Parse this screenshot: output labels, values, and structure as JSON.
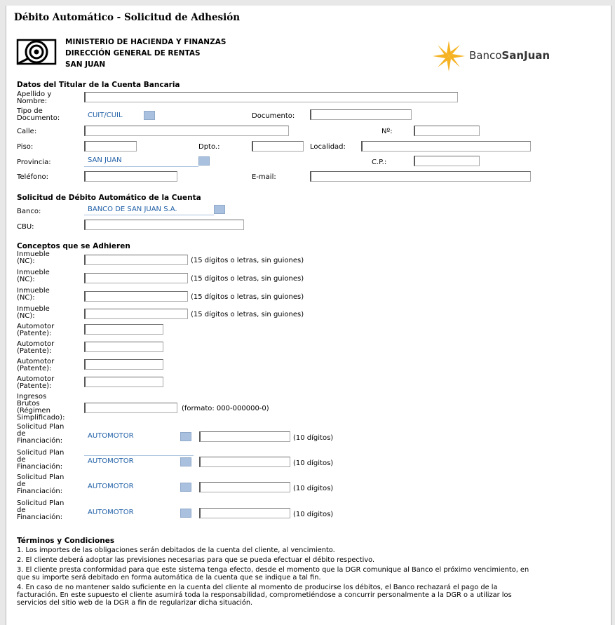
{
  "page_title": "Débito Automático - Solicitud de Adhesión",
  "ministry": {
    "line1": "MINISTERIO DE HACIENDA Y FINANZAS",
    "line2": "DIRECCIÓN GENERAL DE RENTAS",
    "line3": "SAN JUAN"
  },
  "bank_logo": {
    "prefix": "Banco",
    "name": "SanJuan",
    "color": "#f5b323"
  },
  "titular": {
    "heading": "Datos del Titular de la Cuenta Bancaria",
    "apellido_label_1": "Apellido y",
    "apellido_label_2": "Nombre:",
    "tipo_doc_label_1": "Tipo de",
    "tipo_doc_label_2": "Documento:",
    "tipo_doc_value": "CUIT/CUIL",
    "documento_label": "Documento:",
    "calle_label": "Calle:",
    "numero_label": "Nº:",
    "piso_label": "Piso:",
    "dpto_label": "Dpto.:",
    "localidad_label": "Localidad:",
    "provincia_label": "Provincia:",
    "provincia_value": "SAN JUAN",
    "cp_label": "C.P.:",
    "telefono_label": "Teléfono:",
    "email_label": "E-mail:"
  },
  "solicitud": {
    "heading": "Solicitud de Débito Automático de la Cuenta",
    "banco_label": "Banco:",
    "banco_value": "BANCO DE SAN JUAN S.A.",
    "cbu_label": "CBU:"
  },
  "conceptos": {
    "heading": "Conceptos que se Adhieren",
    "inmueble_label_1": "Inmueble",
    "inmueble_label_2": "(NC):",
    "inmueble_hint": "(15 dígitos o letras, sin guiones)",
    "automotor_label_1": "Automotor",
    "automotor_label_2": "(Patente):",
    "ingresos_label_1": "Ingresos",
    "ingresos_label_2": "Brutos",
    "ingresos_label_3": "(Régimen",
    "ingresos_label_4": "Simplificado):",
    "ingresos_hint": "(formato: 000-000000-0)",
    "plan_label_1": "Solicitud Plan",
    "plan_label_2": "de",
    "plan_label_3": "Financiación:",
    "plan_value": "AUTOMOTOR",
    "plan_hint": "(10 dígitos)"
  },
  "terms": {
    "heading": "Términos y Condiciones",
    "t1": "1. Los importes de las obligaciones serán debitados de la cuenta del cliente, al vencimiento.",
    "t2": "2. El cliente deberá adoptar las previsiones necesarias para que se pueda efectuar el débito respectivo.",
    "t3": "3. El cliente presta conformidad para que este sistema tenga efecto, desde el momento que la DGR comunique al Banco el próximo vencimiento, en que su importe será debitado en forma automática de la cuenta que se indique a tal fin.",
    "t4": "4. En caso de no mantener saldo suficiente en la cuenta del cliente al momento de producirse los débitos, el Banco rechazará el pago de la facturación. En este supuesto el cliente asumirá toda la responsabilidad, comprometiéndose a concurrir personalmente a la DGR o a utilizar los servicios del sitio web de la DGR a fin de regularizar dicha situación."
  }
}
